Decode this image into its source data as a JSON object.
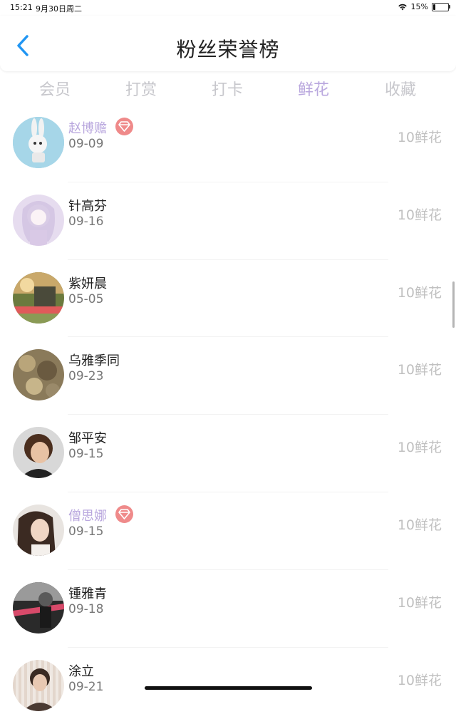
{
  "status_bar": {
    "time": "15:21",
    "date": "9月30日周二",
    "battery": "15%",
    "battery_level": 0.15
  },
  "header": {
    "title": "粉丝荣誉榜"
  },
  "tabs": [
    {
      "label": "会员",
      "active": false
    },
    {
      "label": "打赏",
      "active": false
    },
    {
      "label": "打卡",
      "active": false
    },
    {
      "label": "鲜花",
      "active": true
    },
    {
      "label": "收藏",
      "active": false
    }
  ],
  "colors": {
    "accent": "#b9a7de",
    "inactive_tab": "#c7c7cc",
    "amount": "#c0c0c0",
    "gem_badge": "#ef8a8a",
    "back_arrow": "#2196f3"
  },
  "list": {
    "items": [
      {
        "name": "赵博赡",
        "date": "09-09",
        "amount": "10鲜花",
        "vip": true
      },
      {
        "name": "针高芬",
        "date": "09-16",
        "amount": "10鲜花",
        "vip": false
      },
      {
        "name": "紫妍晨",
        "date": "05-05",
        "amount": "10鲜花",
        "vip": false
      },
      {
        "name": "乌雅季同",
        "date": "09-23",
        "amount": "10鲜花",
        "vip": false
      },
      {
        "name": "邹平安",
        "date": "09-15",
        "amount": "10鲜花",
        "vip": false
      },
      {
        "name": "僧思娜",
        "date": "09-15",
        "amount": "10鲜花",
        "vip": true
      },
      {
        "name": "锺雅青",
        "date": "09-18",
        "amount": "10鲜花",
        "vip": false
      },
      {
        "name": "涂立",
        "date": "09-21",
        "amount": "10鲜花",
        "vip": false
      }
    ]
  }
}
